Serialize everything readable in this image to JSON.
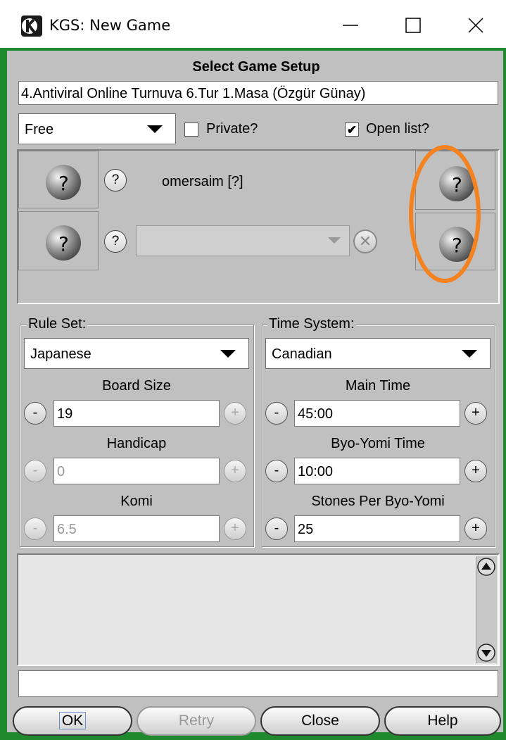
{
  "window": {
    "title": "KGS: New Game",
    "minimize_icon": "minimize-icon",
    "maximize_icon": "maximize-icon",
    "close_icon": "close-icon"
  },
  "header": {
    "heading": "Select Game Setup",
    "game_title": "4.Antiviral Online Turnuva 6.Tur 1.Masa (Özgür Günay)"
  },
  "options": {
    "game_type": "Free",
    "private_label": "Private?",
    "private_checked": false,
    "open_list_label": "Open list?",
    "open_list_checked": true,
    "check_mark": "✔"
  },
  "players": {
    "help_symbol": "?",
    "player1_name": "omersaim [?]",
    "player2_value": "",
    "remove_symbol": "✕"
  },
  "rules": {
    "group_label": "Rule Set:",
    "rule_set": "Japanese",
    "board_size_label": "Board Size",
    "board_size": "19",
    "handicap_label": "Handicap",
    "handicap": "0",
    "komi_label": "Komi",
    "komi": "6.5"
  },
  "time": {
    "group_label": "Time System:",
    "time_system": "Canadian",
    "main_time_label": "Main Time",
    "main_time": "45:00",
    "byo_yomi_label": "Byo-Yomi Time",
    "byo_yomi": "10:00",
    "stones_label": "Stones Per Byo-Yomi",
    "stones": "25"
  },
  "stepper": {
    "minus": "-",
    "plus": "+"
  },
  "chat": {
    "input_value": ""
  },
  "buttons": {
    "ok": "OK",
    "retry": "Retry",
    "close": "Close",
    "help": "Help"
  },
  "annotation": {
    "color": "#f58220"
  }
}
